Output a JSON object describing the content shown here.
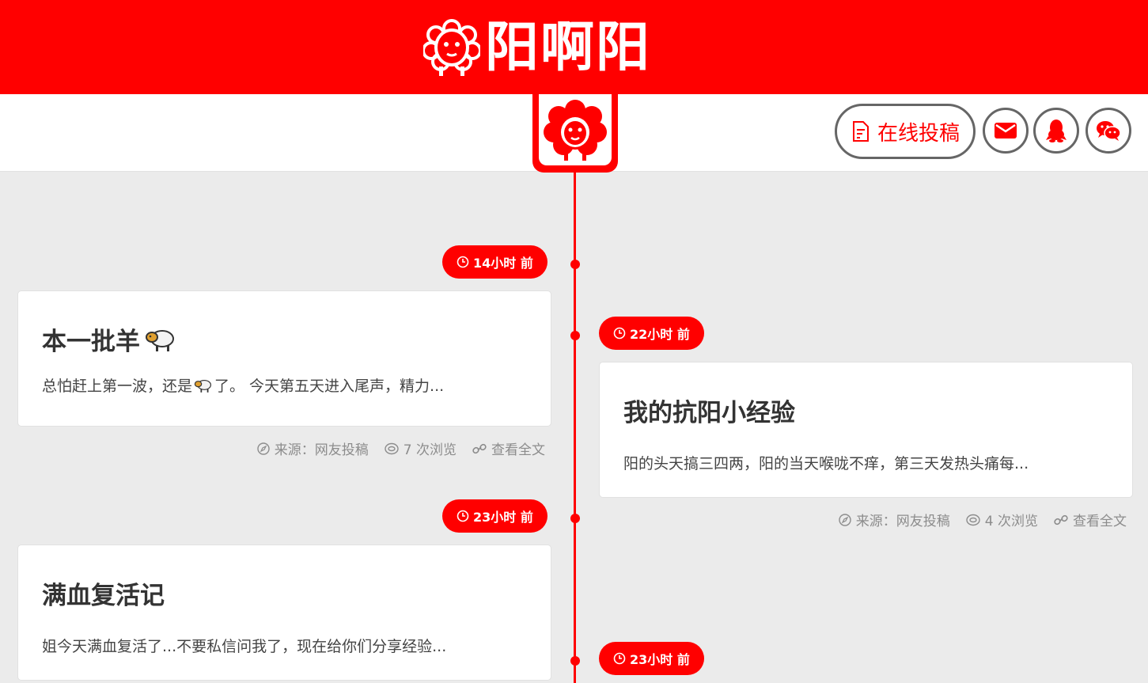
{
  "site": {
    "logo_text": "阳啊阳"
  },
  "nav": {
    "submit_label": "在线投稿",
    "icons": [
      "mail-icon",
      "qq-penguin-icon",
      "wechat-icon"
    ]
  },
  "colors": {
    "brand_red": "#ff0000",
    "border_gray": "#666666",
    "meta_gray": "#8c8c8c"
  },
  "posts": [
    {
      "time": "14小时 前",
      "title": "本一批羊",
      "excerpt_a": "总怕赶上第一波，还是",
      "excerpt_b": "了。 今天第五天进入尾声，精力...",
      "source": "来源：网友投稿",
      "views": "7 次浏览",
      "read_more": "查看全文"
    },
    {
      "time": "22小时 前",
      "title": "我的抗阳小经验",
      "excerpt": "阳的头天搞三四两，阳的当天喉咙不痒，第三天发热头痛每...",
      "source": "来源：网友投稿",
      "views": "4 次浏览",
      "read_more": "查看全文"
    },
    {
      "time": "23小时 前",
      "title": "满血复活记",
      "excerpt": "姐今天满血复活了...不要私信问我了，现在给你们分享经验..."
    },
    {
      "time": "23小时 前"
    }
  ]
}
